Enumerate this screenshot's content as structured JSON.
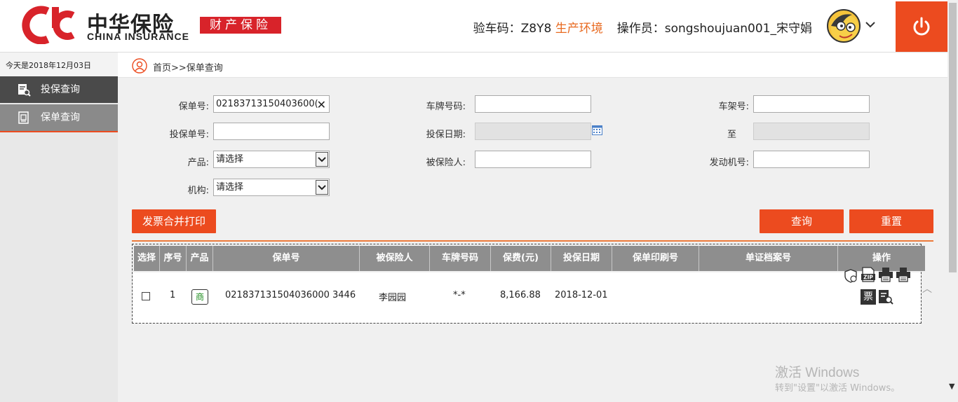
{
  "header": {
    "logo_cn": "中华保险",
    "logo_en": "CHINA INSURANCE",
    "logo_tag": "财产保险",
    "check_code_label": "验车码：",
    "check_code": "Z8Y8",
    "env": "生产环境",
    "operator_label": "操作员：",
    "operator": "songshoujuan001_宋守娟",
    "accent_color": "#ec4b1f"
  },
  "sidebar": {
    "today": "今天是2018年12月03日",
    "items": [
      {
        "label": "投保查询",
        "icon": "search-doc-icon"
      },
      {
        "label": "保单查询",
        "icon": "policy-doc-icon"
      }
    ]
  },
  "breadcrumb": "首页>>保单查询",
  "form": {
    "policy_no_label": "保单号:",
    "policy_no_value": "02183713150403600(",
    "plate_label": "车牌号码:",
    "plate_value": "",
    "frame_label": "车架号:",
    "frame_value": "",
    "app_no_label": "投保单号:",
    "app_no_value": "",
    "app_date_label": "投保日期:",
    "to_label": "至",
    "product_label": "产品:",
    "product_value": "请选择",
    "insured_label": "被保险人:",
    "insured_value": "",
    "engine_label": "发动机号:",
    "engine_value": "",
    "org_label": "机构:",
    "org_value": "请选择"
  },
  "buttons": {
    "invoice_print": "发票合并打印",
    "query": "查询",
    "reset": "重置"
  },
  "table": {
    "headers": [
      "选择",
      "序号",
      "产品",
      "保单号",
      "被保险人",
      "车牌号码",
      "保费(元)",
      "投保日期",
      "保单印刷号",
      "单证档案号",
      "操作"
    ],
    "rows": [
      {
        "seq": "1",
        "product": "商",
        "policy_no": "021837131504036000 3446",
        "insured": "李园园",
        "plate": "*-*",
        "premium": "8,166.88",
        "date": "2018-12-01",
        "print_no": "",
        "archive_no": ""
      }
    ],
    "op_invoice_label": "票",
    "op_zip_label": "ZIP"
  },
  "watermark": {
    "line1": "激活 Windows",
    "line2": "转到\"设置\"以激活 Windows。"
  }
}
